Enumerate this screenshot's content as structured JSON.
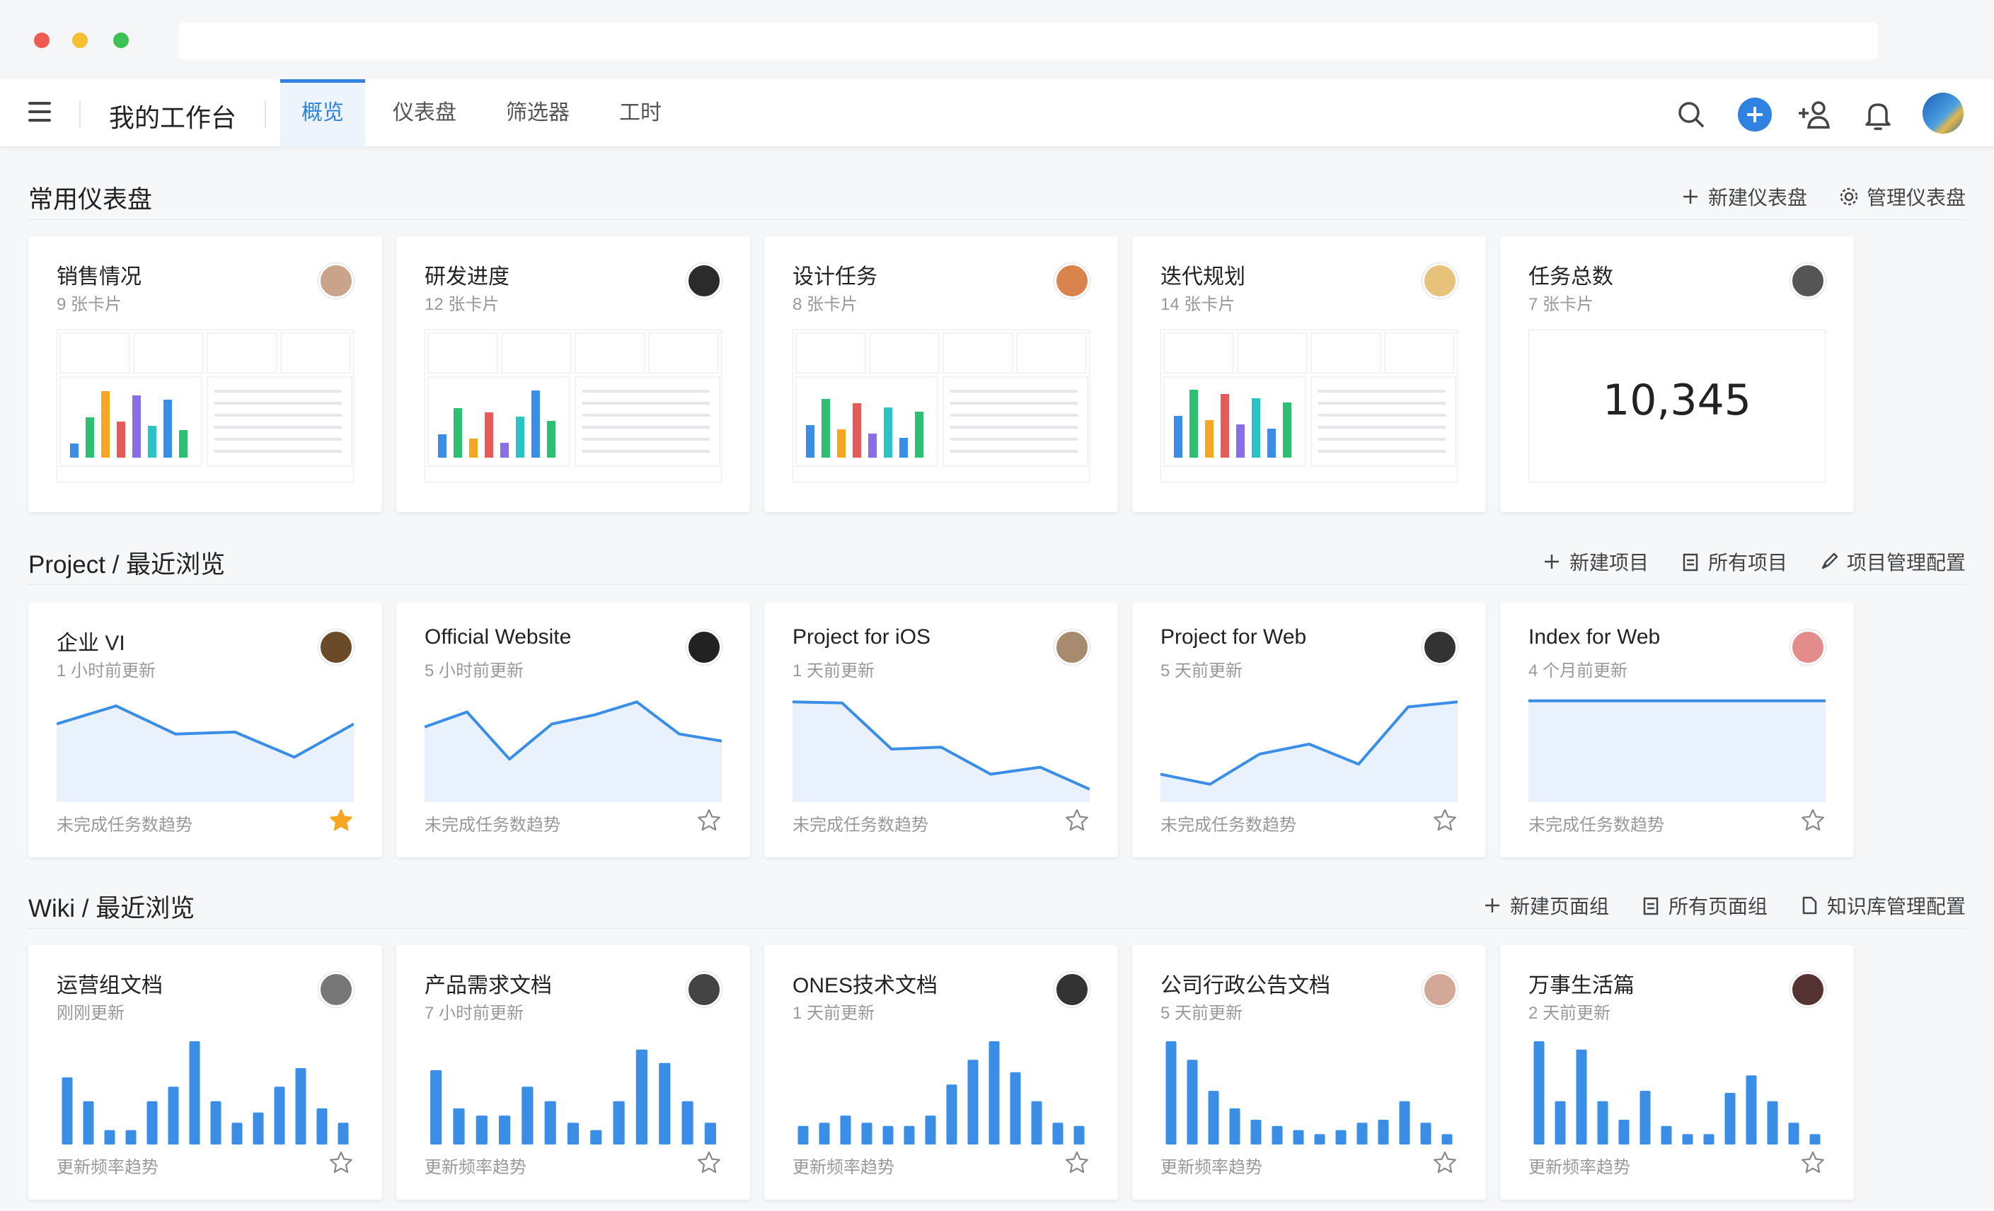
{
  "app": {
    "title": "我的工作台"
  },
  "tabs": [
    {
      "label": "概览",
      "active": true
    },
    {
      "label": "仪表盘"
    },
    {
      "label": "筛选器"
    },
    {
      "label": "工时"
    }
  ],
  "dashboards": {
    "title": "常用仪表盘",
    "actions": [
      "新建仪表盘",
      "管理仪表盘"
    ],
    "cards": [
      {
        "title": "销售情况",
        "sub": "9 张卡片",
        "avatar_color": "#c9a48a"
      },
      {
        "title": "研发进度",
        "sub": "12 张卡片",
        "avatar_color": "#2b2b2b"
      },
      {
        "title": "设计任务",
        "sub": "8 张卡片",
        "avatar_color": "#d9844c"
      },
      {
        "title": "迭代规划",
        "sub": "14 张卡片",
        "avatar_color": "#e6c27a"
      },
      {
        "title": "任务总数",
        "sub": "7 张卡片",
        "avatar_color": "#555555",
        "big_number": "10,345"
      }
    ]
  },
  "projects": {
    "title": "Project / 最近浏览",
    "actions": [
      "新建项目",
      "所有项目",
      "项目管理配置"
    ],
    "cards": [
      {
        "title": "企业 VI",
        "sub": "1 小时前更新",
        "foot": "未完成任务数趋势",
        "starred": true,
        "avatar_color": "#6b4a2a",
        "trend": [
          0.25,
          0.07,
          0.35,
          0.33,
          0.58,
          0.25
        ]
      },
      {
        "title": "Official Website",
        "sub": "5 小时前更新",
        "foot": "未完成任务数趋势",
        "starred": false,
        "avatar_color": "#222222",
        "trend": [
          0.28,
          0.13,
          0.6,
          0.25,
          0.16,
          0.03,
          0.35,
          0.42
        ]
      },
      {
        "title": "Project for iOS",
        "sub": "1 天前更新",
        "foot": "未完成任务数趋势",
        "starred": false,
        "avatar_color": "#a88b6e",
        "trend": [
          0.03,
          0.04,
          0.5,
          0.48,
          0.75,
          0.68,
          0.9
        ]
      },
      {
        "title": "Project for Web",
        "sub": "5 天前更新",
        "foot": "未完成任务数趋势",
        "starred": false,
        "avatar_color": "#333333",
        "trend": [
          0.75,
          0.85,
          0.55,
          0.45,
          0.65,
          0.08,
          0.03
        ]
      },
      {
        "title": "Index for Web",
        "sub": "4 个月前更新",
        "foot": "未完成任务数趋势",
        "starred": false,
        "avatar_color": "#e48c8c",
        "trend": [
          0.02,
          0.02
        ]
      }
    ]
  },
  "wikis": {
    "title": "Wiki / 最近浏览",
    "actions": [
      "新建页面组",
      "所有页面组",
      "知识库管理配置"
    ],
    "cards": [
      {
        "title": "运营组文档",
        "sub": "刚刚更新",
        "foot": "更新频率趋势",
        "avatar_color": "#777777",
        "bars": [
          0.65,
          0.42,
          0.14,
          0.14,
          0.42,
          0.56,
          1.0,
          0.42,
          0.21,
          0.31,
          0.56,
          0.74,
          0.35,
          0.21
        ]
      },
      {
        "title": "产品需求文档",
        "sub": "7 小时前更新",
        "foot": "更新频率趋势",
        "avatar_color": "#444444",
        "bars": [
          0.72,
          0.35,
          0.28,
          0.28,
          0.56,
          0.42,
          0.21,
          0.14,
          0.42,
          0.92,
          0.79,
          0.42,
          0.21
        ]
      },
      {
        "title": "ONES技术文档",
        "sub": "1 天前更新",
        "foot": "更新频率趋势",
        "avatar_color": "#333333",
        "bars": [
          0.18,
          0.21,
          0.28,
          0.21,
          0.18,
          0.18,
          0.28,
          0.58,
          0.82,
          1.0,
          0.7,
          0.42,
          0.21,
          0.18
        ]
      },
      {
        "title": "公司行政公告文档",
        "sub": "5 天前更新",
        "foot": "更新频率趋势",
        "avatar_color": "#d4a898",
        "bars": [
          1.0,
          0.82,
          0.52,
          0.35,
          0.24,
          0.18,
          0.14,
          0.1,
          0.14,
          0.21,
          0.24,
          0.42,
          0.21,
          0.1
        ]
      },
      {
        "title": "万事生活篇",
        "sub": "2 天前更新",
        "foot": "更新频率趋势",
        "avatar_color": "#553333",
        "bars": [
          1.0,
          0.42,
          0.92,
          0.42,
          0.24,
          0.52,
          0.18,
          0.1,
          0.1,
          0.5,
          0.67,
          0.42,
          0.21,
          0.1
        ]
      }
    ]
  },
  "colors": {
    "accent": "#2f82e0",
    "bar": "#3a8ee6",
    "area": "#e9f2fc",
    "star": "#f5a623"
  },
  "icons": {
    "search": "search-icon",
    "add": "add-icon",
    "invite": "add-user-icon",
    "bell": "bell-icon",
    "star": "star-icon"
  }
}
